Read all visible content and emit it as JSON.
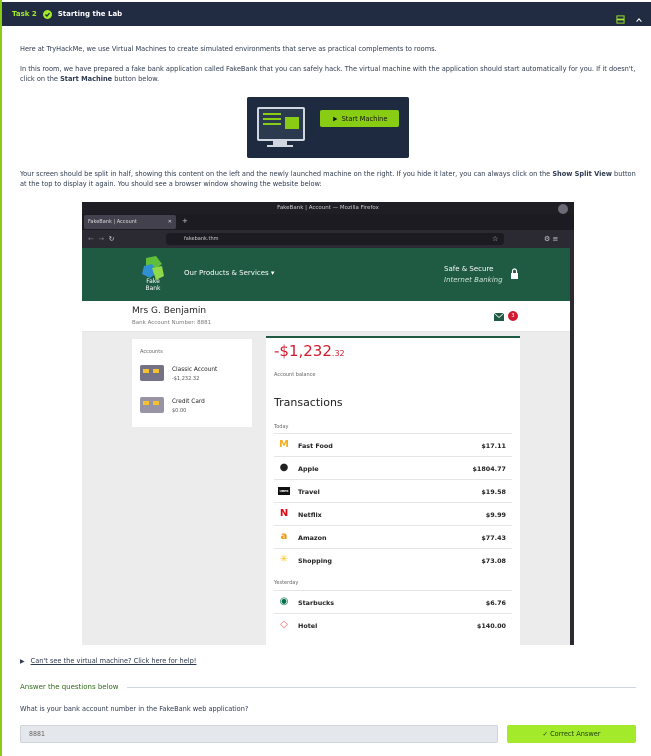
{
  "task": {
    "number": "Task 2",
    "title": "Starting the Lab"
  },
  "paragraphs": {
    "p1": "Here at TryHackMe, we use Virtual Machines to create simulated environments that serve as practical complements to rooms.",
    "p2a": "In this room, we have prepared a fake bank application called FakeBank that you can safely hack. The virtual machine with the application should start automatically for you. If it doesn't, click on the ",
    "p2b": "Start Machine",
    "p2c": " button below.",
    "p3a": "Your screen should be split in half, showing this content on the left and the newly launched machine on the right. If you hide it later, you can always click on the ",
    "p3b": "Show Split View",
    "p3c": " button at the top to display it again. You should see a browser window showing the website below:"
  },
  "start_button": {
    "label": "Start Machine"
  },
  "browser": {
    "window_title": "FakeBank | Account — Mozilla Firefox",
    "tab_label": "FakeBank | Account",
    "url": "fakebank.thm"
  },
  "fakebank": {
    "logo_text_1": "Fake",
    "logo_text_2": "Bank",
    "nav": "Our Products & Services ▾",
    "safe_line1": "Safe & Secure",
    "safe_line2": "Internet Banking",
    "user_name": "Mrs G. Benjamin",
    "account_number_line": "Bank Account Number: 8881",
    "notification_count": "3",
    "accounts_label": "Accounts",
    "accounts": [
      {
        "name": "Classic Account",
        "balance": "-$1,232.32"
      },
      {
        "name": "Credit Card",
        "balance": "$0.00"
      }
    ],
    "balance_main": "-$1,232",
    "balance_cents": ".32",
    "balance_label": "Account balance",
    "transactions_title": "Transactions",
    "today_label": "Today",
    "yesterday_label": "Yesterday",
    "today": [
      {
        "name": "Fast Food",
        "amount": "$17.11",
        "icon": "mcdonalds-icon"
      },
      {
        "name": "Apple",
        "amount": "$1804.77",
        "icon": "apple-icon"
      },
      {
        "name": "Travel",
        "amount": "$19.58",
        "icon": "uber-icon"
      },
      {
        "name": "Netflix",
        "amount": "$9.99",
        "icon": "netflix-icon"
      },
      {
        "name": "Amazon",
        "amount": "$77.43",
        "icon": "amazon-icon"
      },
      {
        "name": "Shopping",
        "amount": "$73.08",
        "icon": "walmart-icon"
      }
    ],
    "yesterday": [
      {
        "name": "Starbucks",
        "amount": "$6.76",
        "icon": "starbucks-icon"
      },
      {
        "name": "Hotel",
        "amount": "$140.00",
        "icon": "airbnb-icon"
      }
    ]
  },
  "help_link": "Can't see the virtual machine? Click here for help!",
  "answer_section": "Answer the questions below",
  "question": "What is your bank account number in the FakeBank web application?",
  "answer_value": "8881",
  "correct_button": "✓ Correct Answer",
  "colors": {
    "accent": "#88cc14",
    "header_bg": "#212c42",
    "bank_green": "#1f5b43",
    "red": "#d01b2e"
  }
}
